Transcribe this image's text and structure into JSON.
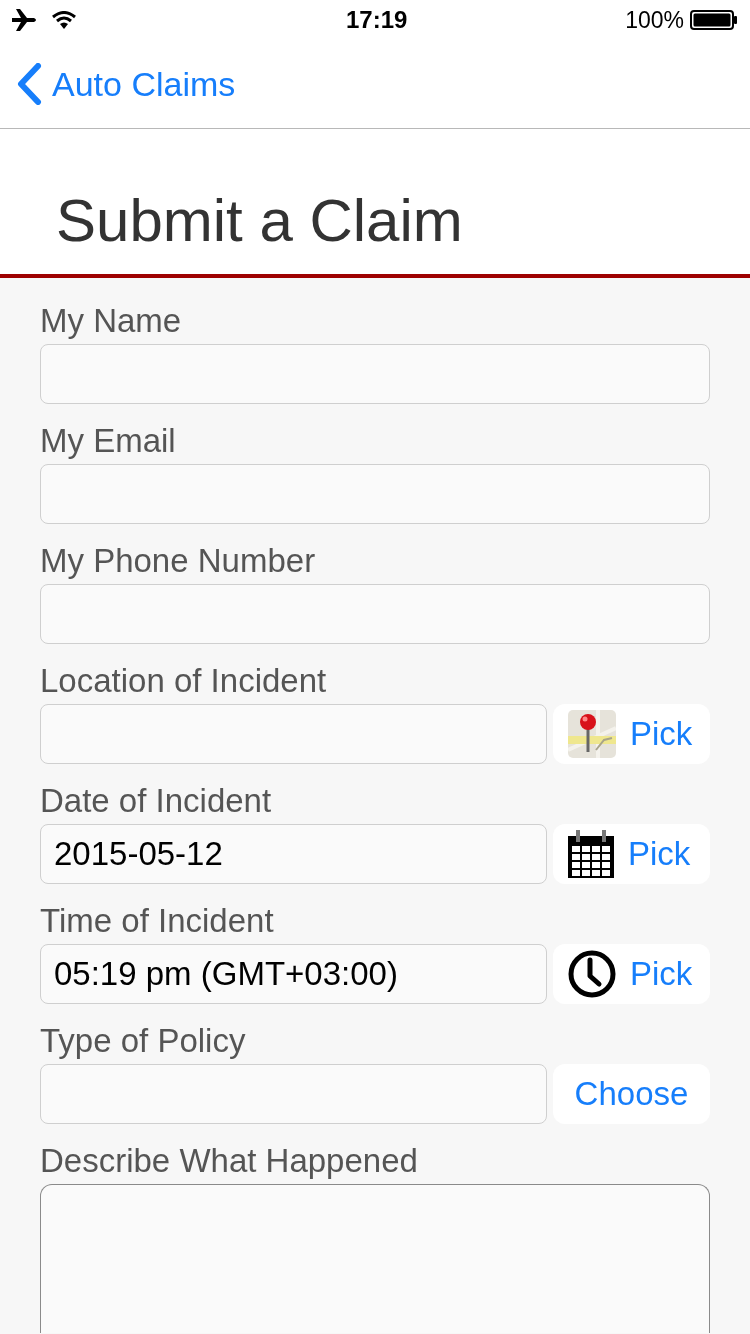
{
  "status_bar": {
    "time": "17:19",
    "battery": "100%"
  },
  "nav": {
    "back": "Auto Claims"
  },
  "title": "Submit a Claim",
  "fields": [
    {
      "kind": "text",
      "label": "My Name"
    },
    {
      "kind": "text",
      "label": "My Email"
    },
    {
      "kind": "text",
      "label": "My Phone Number"
    },
    {
      "kind": "location",
      "label": "Location of Incident",
      "button": "Pick"
    },
    {
      "kind": "date",
      "label": "Date of Incident",
      "value": "2015-05-12",
      "button": "Pick"
    },
    {
      "kind": "time",
      "label": "Time of Incident",
      "value": "05:19 pm (GMT+03:00)",
      "button": "Pick"
    },
    {
      "kind": "choice",
      "label": "Type of Policy",
      "button": "Choose"
    },
    {
      "kind": "textarea",
      "label": "Describe What Happened"
    }
  ]
}
